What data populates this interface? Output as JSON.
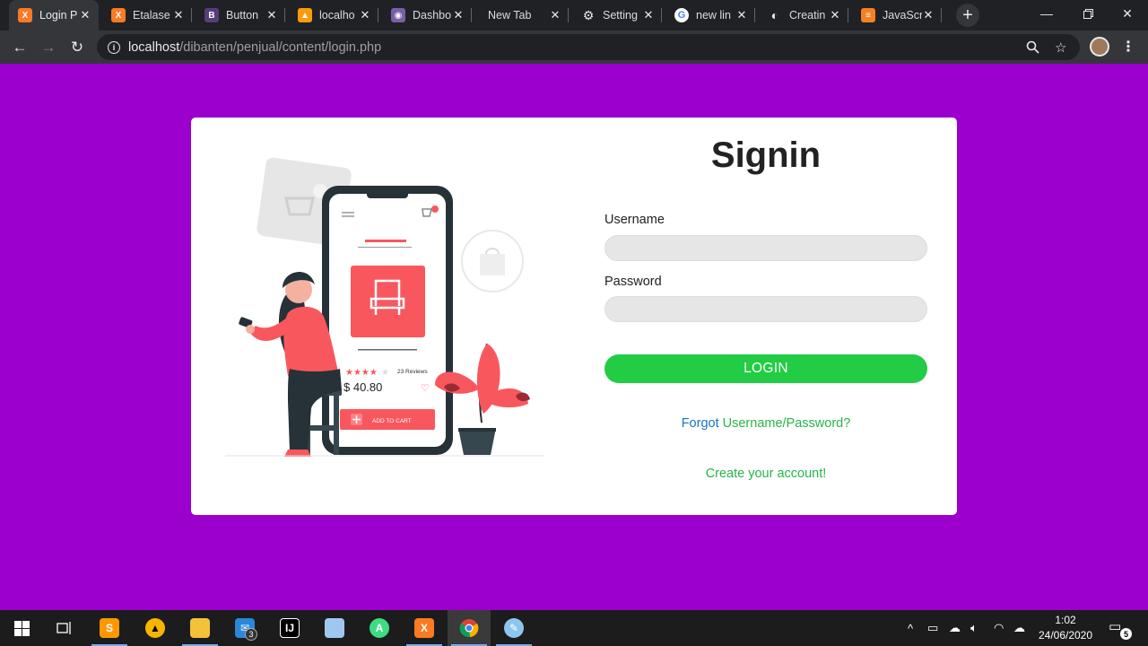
{
  "browser": {
    "tabs": [
      {
        "title": "Login P",
        "icon": "xampp-icon",
        "color": "#fb7a24"
      },
      {
        "title": "Etalase",
        "icon": "xampp-icon",
        "color": "#fb7a24"
      },
      {
        "title": "Button",
        "icon": "bootstrap-icon",
        "color": "#563d7c"
      },
      {
        "title": "localho",
        "icon": "phpmyadmin-icon",
        "color": "#f89c0e"
      },
      {
        "title": "Dashbo",
        "icon": "dashboard-icon",
        "color": "#7a5ea8"
      },
      {
        "title": "New Tab",
        "icon": "",
        "color": ""
      },
      {
        "title": "Setting",
        "icon": "gear-icon",
        "color": "#e8eaed"
      },
      {
        "title": "new lin",
        "icon": "google-icon",
        "color": "#ffffff"
      },
      {
        "title": "Creatin",
        "icon": "globe-icon",
        "color": "#e8eaed"
      },
      {
        "title": "JavaScr",
        "icon": "stackoverflow-icon",
        "color": "#f48024"
      }
    ],
    "close_glyph": "✕",
    "new_tab_glyph": "+",
    "url_host": "localhost",
    "url_path": "/dibanten/penjual/content/login.php"
  },
  "page": {
    "illustration": {
      "rating_text": "23 Reviews",
      "price": "$ 40.80",
      "cart_button": "ADD TO CART"
    },
    "form": {
      "title": "Signin",
      "username_label": "Username",
      "username_value": "",
      "password_label": "Password",
      "password_value": "",
      "login_label": "LOGIN",
      "forgot_prefix": "Forgot",
      "forgot_link": "Username/Password?",
      "create_link": "Create your account!"
    }
  },
  "taskbar": {
    "mail_badge": "3",
    "time": "1:02",
    "date": "24/06/2020",
    "notifications": "5"
  },
  "colors": {
    "page_bg": "#9b00cc",
    "login_button": "#22cc44",
    "forgot_blue": "#1a73c8",
    "link_green": "#28b44a",
    "accent_red": "#f9575e"
  }
}
